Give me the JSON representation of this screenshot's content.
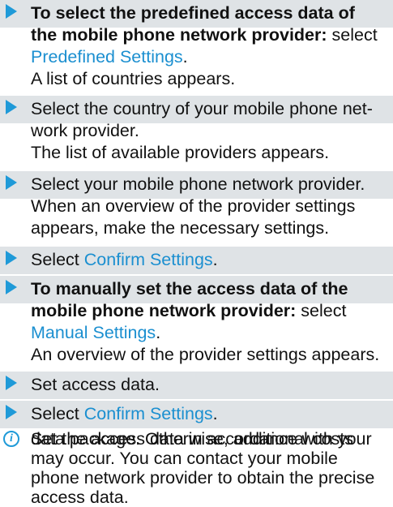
{
  "colors": {
    "arrow": "#1f9ad8",
    "link": "#1b8fd0",
    "step_bg": "#dfe3e6"
  },
  "steps": [
    {
      "line1_bold": "To select the predefined access data of",
      "line2_bold": "the mobile phone network provider:",
      "line2_rest": " select",
      "link": "Predefined Settings",
      "link_suffix": ".",
      "result": "A list of countries appears."
    },
    {
      "line1": "Select the country of your mobile phone net-",
      "line2": "work provider.",
      "result": "The list of available providers appears."
    },
    {
      "line1": "Select your mobile phone network provider.",
      "line2": "When an overview of the provider settings",
      "line3": "appears, make the necessary settings."
    },
    {
      "prefix": "Select ",
      "link": "Confirm Settings",
      "suffix": "."
    },
    {
      "line1_bold": "To manually set the access data of the",
      "line2_bold": "mobile phone network provider:",
      "line2_rest": " select",
      "link": "Manual Settings",
      "link_suffix": ".",
      "result": "An overview of the provider settings appears."
    },
    {
      "text": "Set access data."
    },
    {
      "prefix": "Select ",
      "link": "Confirm Settings",
      "suffix": "."
    }
  ],
  "note": {
    "icon": "info-icon",
    "icon_glyph": "i",
    "lines": [
      "Set the access data in accordance with your",
      "data package. Otherwise, additional costs",
      "may occur. You can contact your mobile",
      "phone network provider to obtain the precise",
      "access data."
    ]
  }
}
